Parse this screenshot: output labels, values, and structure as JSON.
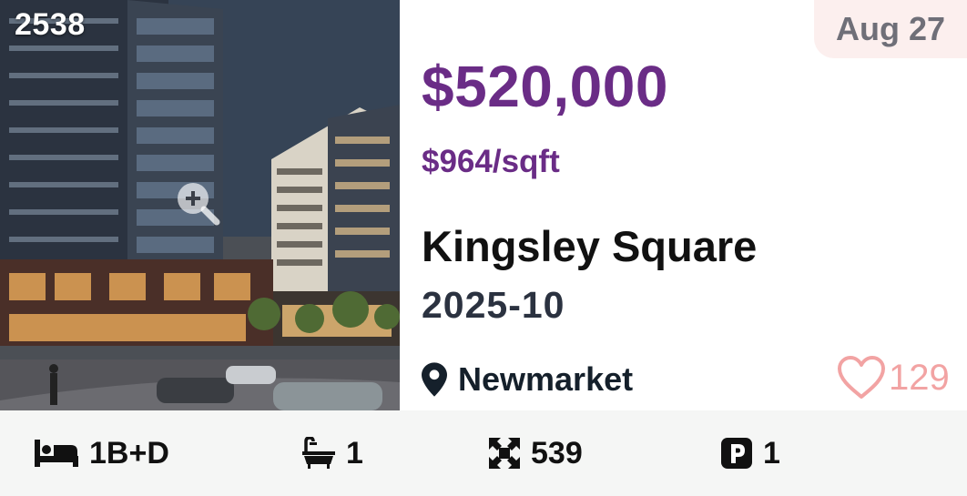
{
  "listing": {
    "id_label": "2538",
    "date": "Aug 27",
    "price": "$520,000",
    "price_per_sqft": "$964/sqft",
    "project_name": "Kingsley Square",
    "completion": "2025-10",
    "location": "Newmarket",
    "favorites_count": "129"
  },
  "stats": {
    "beds": "1B+D",
    "baths": "1",
    "area": "539",
    "parking": "1"
  },
  "icons": {
    "zoom": "zoom-in-icon",
    "location": "map-pin-icon",
    "favorite": "heart-outline-icon",
    "beds": "bed-icon",
    "baths": "bathtub-icon",
    "area": "expand-arrows-icon",
    "parking": "parking-icon"
  },
  "colors": {
    "price": "#6a2c86",
    "date_badge_bg": "#fcefee",
    "heart": "#f2a3a3",
    "stats_bg": "#f5f6f5"
  }
}
